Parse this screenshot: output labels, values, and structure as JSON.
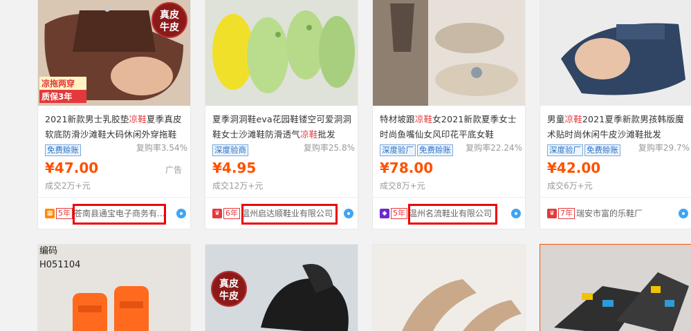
{
  "products": [
    {
      "title_pre": "2021新款男士乳胶垫",
      "title_kw": "凉鞋",
      "title_post": "夏季真皮软底防滑沙滩鞋大码休闲外穿拖鞋",
      "tags": [
        "免费赊账"
      ],
      "rate": "复购率3.54%",
      "price": "¥47.00",
      "ad": "广告",
      "sold": "成交2万+元",
      "badge_color": "#ff8a00",
      "years": "5年",
      "shop": "苍南县通宝电子商务有...",
      "stamp": [
        "真皮",
        "牛皮"
      ],
      "promo": [
        "凉拖两穿",
        "质保3年"
      ],
      "img_colors": [
        "#6b3d2e",
        "#caa28a"
      ]
    },
    {
      "title_pre": "夏季洞洞鞋eva花园鞋镂空可爱洞洞鞋女士沙滩鞋防滑透气",
      "title_kw": "凉鞋",
      "title_post": "批发",
      "tags": [
        "深度验商"
      ],
      "rate": "复购率25.8%",
      "price": "¥4.95",
      "sold": "成交12万+元",
      "badge_color": "#e4393c",
      "years": "6年",
      "shop": "温州启达顺鞋业有限公司",
      "img_colors": [
        "#d7dccc",
        "#b8d48a"
      ]
    },
    {
      "title_pre": "特材坡跟",
      "title_kw": "凉鞋",
      "title_post": "女2021新款夏季女士时尚鱼嘴仙女风印花平底女鞋",
      "tags": [
        "深度验厂",
        "免费赊账"
      ],
      "rate": "复购率22.24%",
      "price": "¥78.00",
      "sold": "成交8万+元",
      "badge_color": "#6a2bd0",
      "years": "5年",
      "shop": "温州名流鞋业有限公司",
      "img_colors": [
        "#a89a8c",
        "#e8e2da"
      ]
    },
    {
      "title_pre": "男童",
      "title_kw": "凉鞋",
      "title_post": "2021夏季新款男孩韩版魔术贴时尚休闲牛皮沙滩鞋批发",
      "tags": [
        "深度验厂",
        "免费赊账"
      ],
      "rate": "复购率29.7%",
      "price": "¥42.00",
      "sold": "成交6万+元",
      "badge_color": "#e4393c",
      "years": "7年",
      "shop": "瑞安市富的乐鞋厂",
      "img_colors": [
        "#3a4d6e",
        "#e9c9b3"
      ]
    }
  ],
  "bottom": [
    {
      "code": [
        "编码",
        "H051104"
      ],
      "img_colors": [
        "#e8e5e0",
        "#ff6a1f"
      ]
    },
    {
      "stamp": [
        "真皮",
        "牛皮"
      ],
      "img_colors": [
        "#d5dbdf",
        "#1c1c1c"
      ]
    },
    {
      "img_colors": [
        "#f1eee9",
        "#c9a98a"
      ]
    },
    {
      "img_colors": [
        "#d9d6d3",
        "#2f2f2f"
      ]
    }
  ]
}
